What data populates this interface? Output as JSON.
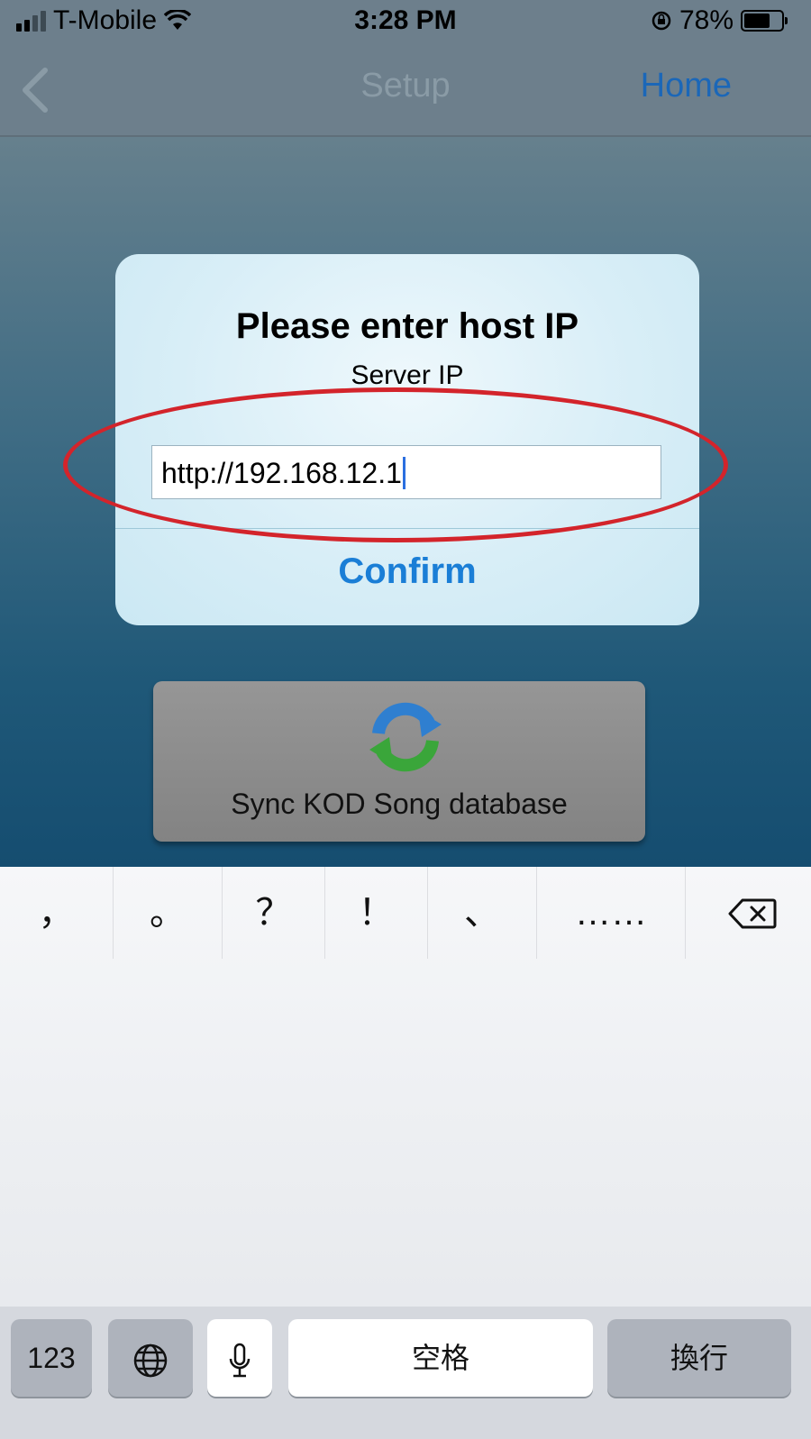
{
  "status_bar": {
    "carrier": "T-Mobile",
    "time": "3:28 PM",
    "battery": "78%",
    "battery_level": 0.78,
    "icons": [
      "signal-icon",
      "wifi-icon",
      "orientation-lock-icon",
      "battery-icon"
    ]
  },
  "nav": {
    "back_icon": "chevron-left-icon",
    "title": "Setup",
    "right_button": "Home"
  },
  "dialog": {
    "title": "Please enter host IP",
    "message": "Server IP",
    "input_value": "http://192.168.12.1",
    "confirm_label": "Confirm"
  },
  "sync_button": {
    "icon": "sync-icon",
    "label": "Sync KOD Song database"
  },
  "keyboard": {
    "candidates": [
      "，",
      "。",
      "？",
      "！",
      "、",
      "……"
    ],
    "delete_icon": "delete-icon",
    "keys": {
      "numbers": "123",
      "globe_icon": "globe-icon",
      "mic_icon": "microphone-icon",
      "space": "空格",
      "return": "換行"
    }
  },
  "colors": {
    "nav_home": "#1b67b8",
    "confirm": "#1a7ed6",
    "highlight": "#d3242b"
  }
}
